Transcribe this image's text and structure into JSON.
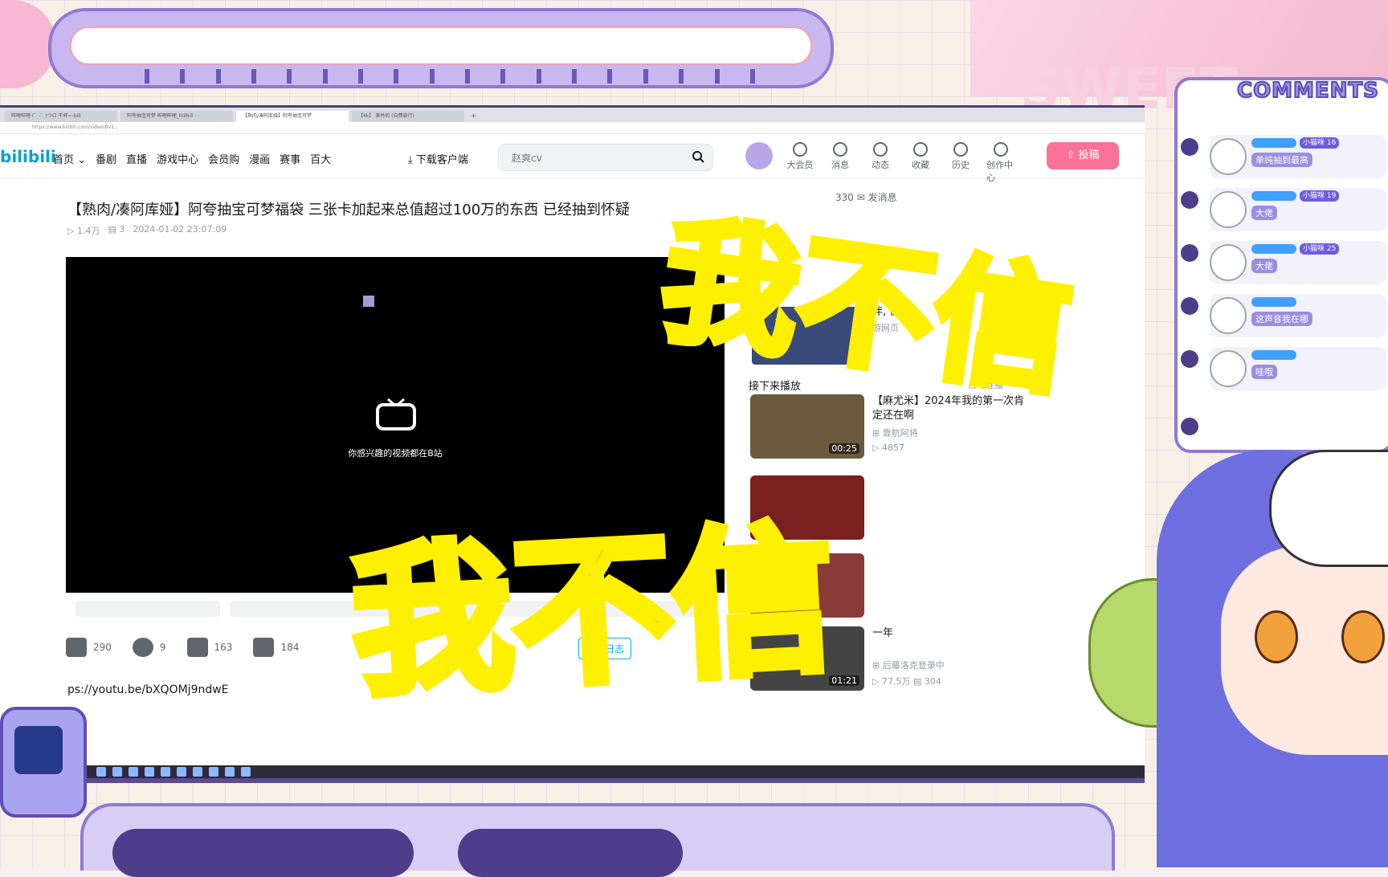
{
  "browser": {
    "tabs": [
      {
        "label": "哔哩哔哩 (゜-゜)つロ 干杯~-bili",
        "active": false
      },
      {
        "label": "阿夸抽宝可梦 哔哩哔哩_bilibili",
        "active": false
      },
      {
        "label": "【熟肉/凑阿库娅】阿夸抽宝可梦",
        "active": true
      },
      {
        "label": "【4k】 事件的 (自费旅行)",
        "active": false
      }
    ],
    "url": "https://www.bilibili.com/video/BV1..."
  },
  "header": {
    "logo": "bilibili",
    "nav": [
      "首页 ⌄",
      "番剧",
      "直播",
      "游戏中心",
      "会员购",
      "漫画",
      "赛事",
      "百大"
    ],
    "download": "⤓ 下载客户端",
    "search_placeholder": "赵爽cv",
    "icons": [
      {
        "label": "大会员",
        "icon": "vip-icon"
      },
      {
        "label": "消息",
        "icon": "message-icon"
      },
      {
        "label": "动态",
        "icon": "dynamic-icon"
      },
      {
        "label": "收藏",
        "icon": "star-icon"
      },
      {
        "label": "历史",
        "icon": "history-icon"
      },
      {
        "label": "创作中心",
        "icon": "creator-icon"
      }
    ],
    "upload": "⇧ 投稿"
  },
  "video": {
    "title": "【熟肉/凑阿库娅】阿夸抽宝可梦福袋 三张卡加起来总值超过100万的东西 已经抽到怀疑",
    "views": "1.4万",
    "danmaku": "3",
    "date": "2024-01-02 23:07:09",
    "player_text": "你感兴趣的视频都在B站",
    "likes": "290",
    "coins": "9",
    "favorites": "163",
    "shares": "184",
    "note_button": "视频日志",
    "description_link": "ps://youtu.be/bXQOMj9ndwE"
  },
  "sidebar": {
    "up_info": "330 ✉ 发消息",
    "ad_text": "伴,      伍!",
    "ad_source": "游网页",
    "next_label": "接下来播放",
    "autoplay": "自动连播",
    "recommendations": [
      {
        "title": "【麻尤米】2024年我的第一次肯定还在啊",
        "up": "⊞ 靠航阿将",
        "stats": "▷ 4857",
        "duration": "00:25"
      },
      {
        "title": "",
        "up": "",
        "stats": "",
        "duration": ""
      },
      {
        "title": "",
        "up": "",
        "stats": "",
        "duration": ""
      },
      {
        "title": "一年",
        "up": "⊞ 后藤洛克登录中",
        "stats": "▷ 77.5万 ▤ 304",
        "duration": "01:21"
      }
    ]
  },
  "comments": {
    "title": "COMMENTS",
    "items": [
      {
        "badge": "小猫咪 16",
        "text": "单纯抽到最高"
      },
      {
        "badge": "小猫咪 19",
        "text": "大佬"
      },
      {
        "badge": "小猫咪 25",
        "text": "大佬"
      },
      {
        "badge": "",
        "text": "这声音我在哪"
      },
      {
        "badge": "",
        "text": "哇哦"
      }
    ]
  },
  "captions": {
    "top": "我不信",
    "bottom": "我不信"
  },
  "colors": {
    "caption_fill": "#ff1a1a",
    "caption_stroke": "#ffef00",
    "bili_pink": "#fb7299",
    "bili_blue": "#00a1d6",
    "overlay_purple": "#8f7ad6"
  }
}
